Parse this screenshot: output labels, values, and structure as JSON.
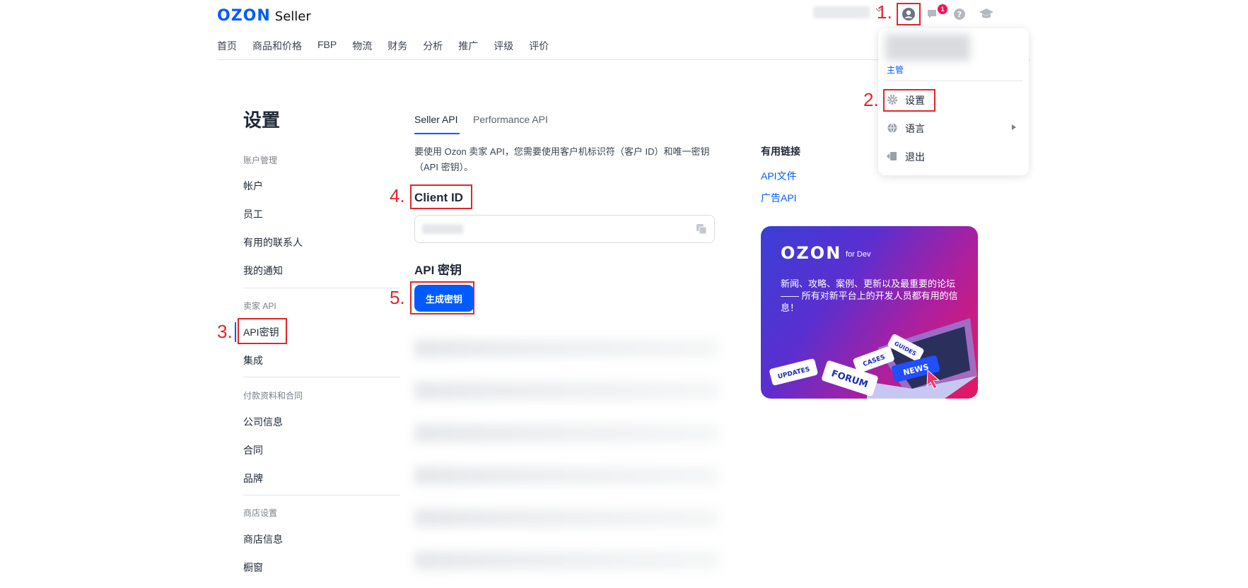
{
  "header": {
    "logo_brand": "OZON",
    "logo_product": "Seller",
    "notification_count": "1",
    "nav": [
      "首页",
      "商品和价格",
      "FBP",
      "物流",
      "财务",
      "分析",
      "推广",
      "评级",
      "评价"
    ]
  },
  "dropdown": {
    "role": "主管",
    "settings": "设置",
    "language": "语言",
    "logout": "退出"
  },
  "sidebar": {
    "title": "设置",
    "groups": [
      {
        "label": "账户管理",
        "items": [
          "帐户",
          "员工",
          "有用的联系人",
          "我的通知"
        ]
      },
      {
        "label": "卖家 API",
        "items": [
          "API密钥",
          "集成"
        ]
      },
      {
        "label": "付款资料和合同",
        "items": [
          "公司信息",
          "合同",
          "品牌"
        ]
      },
      {
        "label": "商店设置",
        "items": [
          "商店信息",
          "橱窗"
        ]
      }
    ]
  },
  "main": {
    "tabs": [
      "Seller API",
      "Performance API"
    ],
    "intro": "要使用 Ozon 卖家 API，您需要使用客户机标识符（客户 ID）和唯一密钥（API 密钥）。",
    "client_id_label": "Client ID",
    "api_key_label": "API 密钥",
    "generate_button": "生成密钥"
  },
  "right": {
    "links_title": "有用链接",
    "links": [
      "API文件",
      "广告API"
    ],
    "promo": {
      "logo": "OZON",
      "subtitle": "for Dev",
      "text": "新闻、攻略、案例、更新以及最重要的论坛—— 所有对新平台上的开发人员都有用的信息！",
      "tags": [
        "UPDATES",
        "FORUM",
        "CASES",
        "NEWS",
        "GUIDES"
      ]
    }
  },
  "annotations": [
    "1.",
    "2.",
    "3.",
    "4.",
    "5."
  ],
  "colors": {
    "brand": "#005bff",
    "annotation": "#e0262b",
    "badge": "#f91155"
  },
  "icons": [
    "user-circle-icon",
    "chat-icon",
    "help-icon",
    "graduation-cap-icon",
    "gear-icon",
    "globe-icon",
    "logout-icon",
    "copy-icon"
  ]
}
